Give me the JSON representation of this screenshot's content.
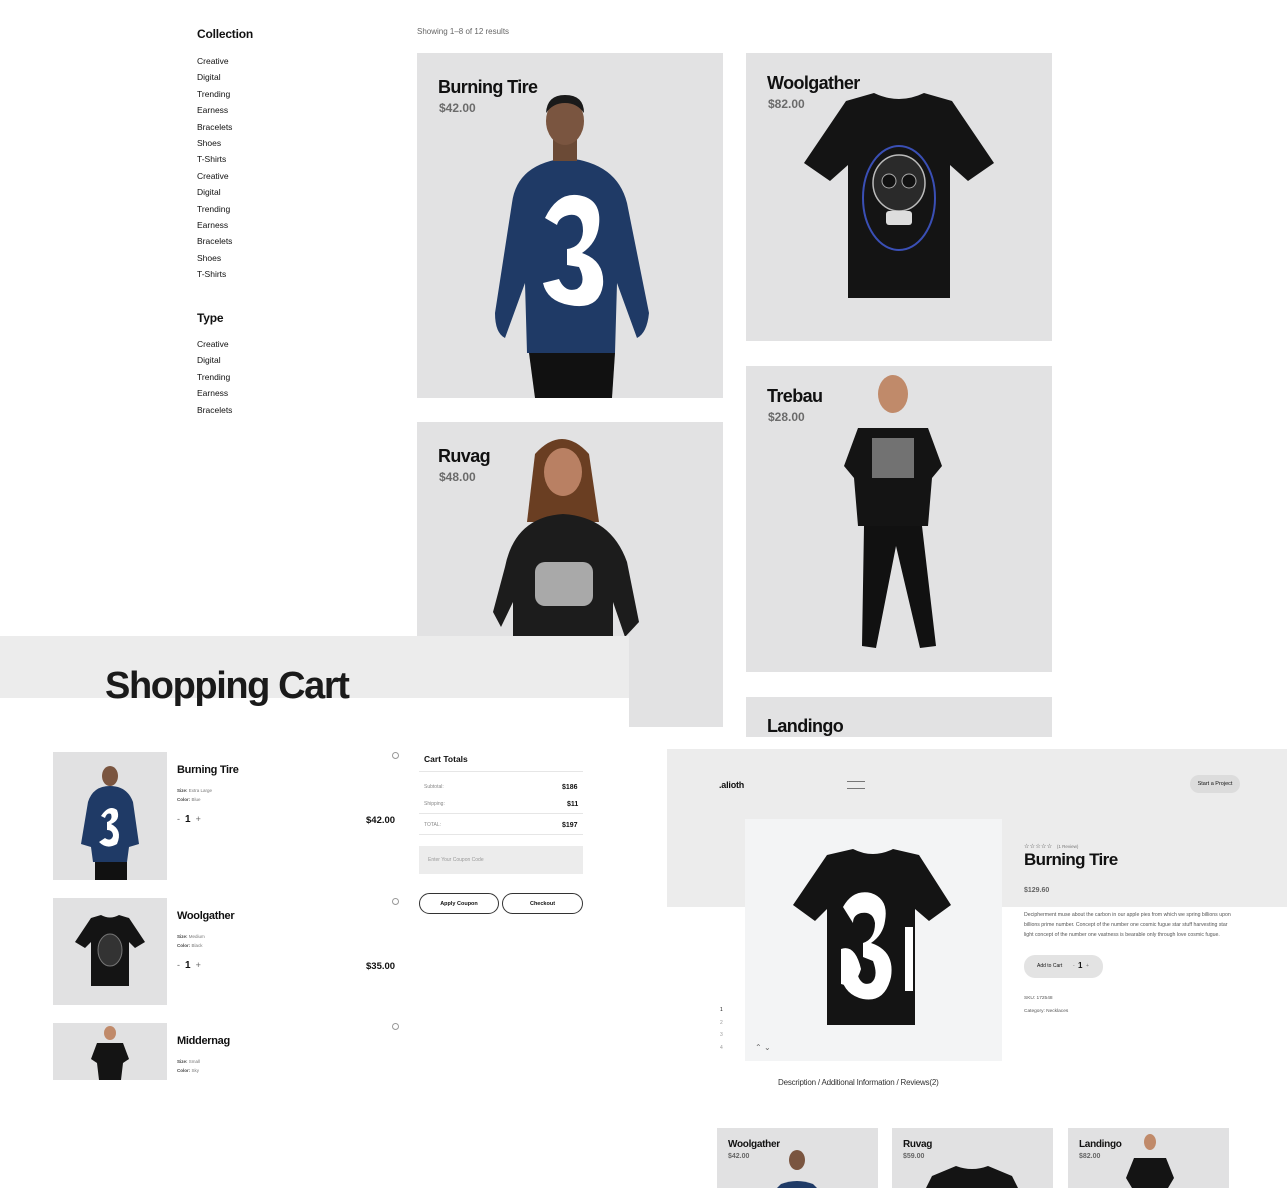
{
  "sidebar": {
    "collection_heading": "Collection",
    "collection": [
      "Creative",
      "Digital",
      "Trending",
      "Earness",
      "Bracelets",
      "Shoes",
      "T-Shirts",
      "Creative",
      "Digital",
      "Trending",
      "Earness",
      "Bracelets",
      "Shoes",
      "T-Shirts"
    ],
    "type_heading": "Type",
    "type": [
      "Creative",
      "Digital",
      "Trending",
      "Earness",
      "Bracelets"
    ]
  },
  "shop": {
    "results": "Showing 1–8 of 12 results",
    "products": [
      {
        "name": "Burning Tire",
        "price": "$42.00"
      },
      {
        "name": "Woolgather",
        "price": "$82.00"
      },
      {
        "name": "Ruvag",
        "price": "$48.00"
      },
      {
        "name": "Trebau",
        "price": "$28.00"
      },
      {
        "name": "Landingo",
        "price": ""
      }
    ]
  },
  "cart": {
    "title": "Shopping Cart",
    "items": [
      {
        "name": "Burning Tire",
        "size_label": "Size:",
        "size": "Extra Large",
        "color_label": "Color:",
        "color": "Blue",
        "qty": "1",
        "price": "$42.00"
      },
      {
        "name": "Woolgather",
        "size_label": "Size:",
        "size": "Medium",
        "color_label": "Color:",
        "color": "Black",
        "qty": "1",
        "price": "$35.00"
      },
      {
        "name": "Middernag",
        "size_label": "Size:",
        "size": "Small",
        "color_label": "Color:",
        "color": "Sky",
        "qty": "",
        "price": ""
      }
    ],
    "qty_minus": "-",
    "qty_plus": "+",
    "totals": {
      "heading": "Cart Totals",
      "subtotal_label": "Subtotal:",
      "subtotal": "$186",
      "shipping_label": "Shipping:",
      "shipping": "$11",
      "total_label": "TOTAL:",
      "total": "$197",
      "coupon_placeholder": "Enter Your Coupon Code",
      "apply": "Apply Coupon",
      "checkout": "Checkout"
    }
  },
  "product_page": {
    "logo": ".alioth",
    "start": "Start a Project",
    "stars": "☆☆☆☆☆",
    "reviews_small": "(1 Review)",
    "name": "Burning Tire",
    "price": "$129.60",
    "desc": [
      "Decipherment muse about the carbon in our apple pies from which we spring billions upon",
      "billions prime number. Concept of the number one cosmic fugue star stuff harvesting star",
      "light concept of the number one vastness is bearable only through love cosmic fugue."
    ],
    "add_to_cart": "Add to Cart",
    "qty": "1",
    "sku": "SKU: 172548",
    "category": "Category: Necklaces",
    "gallery_nums": [
      "1",
      "2",
      "3",
      "4"
    ],
    "tabs": {
      "description": "Description",
      "additional": "/ Additional Information",
      "reviews": "/ Reviews(2)"
    },
    "related": [
      {
        "name": "Woolgather",
        "price": "$42.00"
      },
      {
        "name": "Ruvag",
        "price": "$59.00"
      },
      {
        "name": "Landingo",
        "price": "$82.00"
      }
    ]
  },
  "colors": {
    "card_bg": "#e2e2e3",
    "navy": "#1f3a66",
    "shirt": "#141414",
    "accent_blue": "#3a4fb5"
  }
}
